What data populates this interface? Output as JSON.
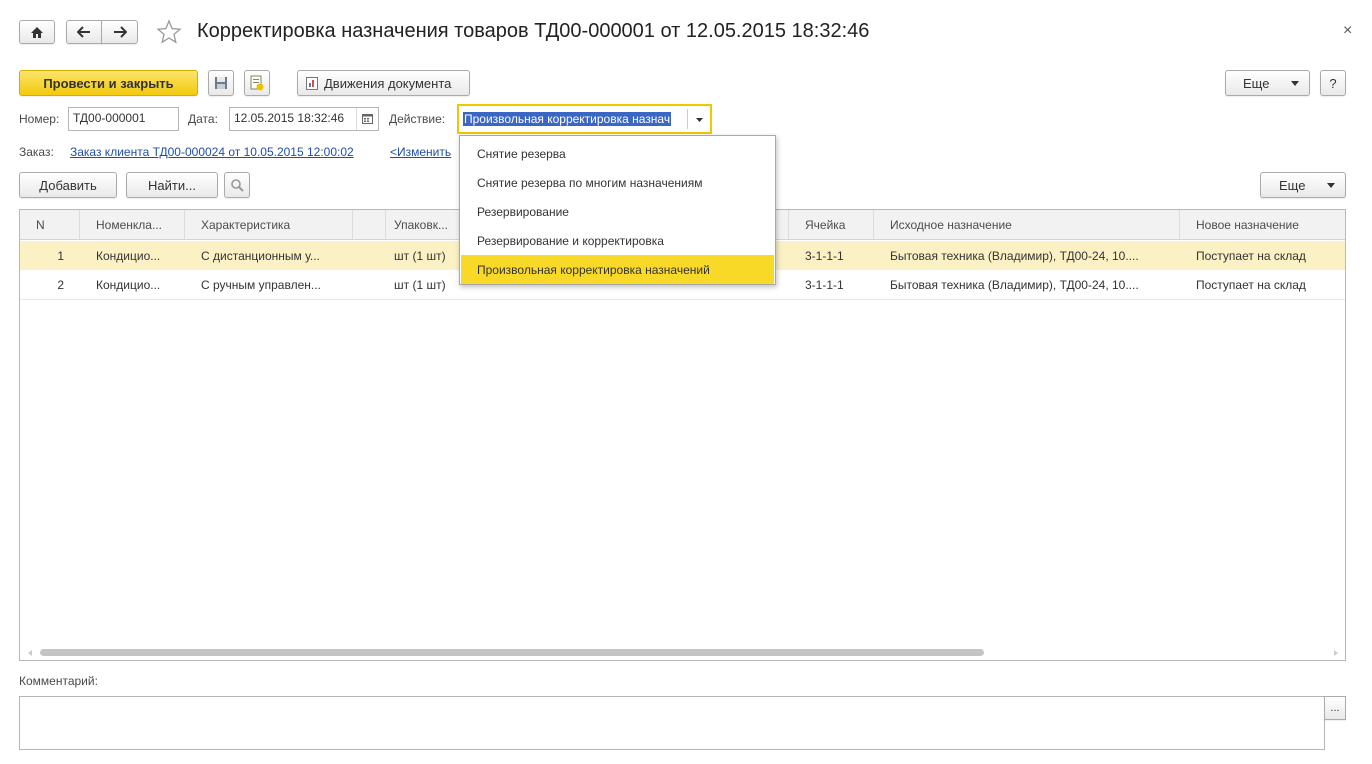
{
  "window": {
    "title": "Корректировка назначения товаров ТД00-000001 от 12.05.2015 18:32:46",
    "close_label": "×"
  },
  "toolbar": {
    "post_close_label": "Провести и закрыть",
    "movements_label": "Движения документа",
    "more_label": "Еще",
    "help_label": "?"
  },
  "form": {
    "number_label": "Номер:",
    "number_value": "ТД00-000001",
    "date_label": "Дата:",
    "date_value": "12.05.2015 18:32:46",
    "action_label": "Действие:",
    "action_value": "Произвольная корректировка назнач",
    "order_label": "Заказ:",
    "order_link": "Заказ клиента ТД00-000024 от 10.05.2015 12:00:02",
    "change_link": "<Изменить"
  },
  "table_toolbar": {
    "add_label": "Добавить",
    "find_label": "Найти...",
    "more_label": "Еще"
  },
  "table": {
    "columns": [
      "N",
      "Номенкла...",
      "Характеристика",
      "",
      "Упаковк...",
      "",
      "Ячейка",
      "Исходное назначение",
      "Новое назначение"
    ],
    "rows": [
      [
        "1",
        "Кондицио...",
        "С дистанционным у...",
        "",
        "шт (1 шт)",
        "",
        "3-1-1-1",
        "Бытовая техника (Владимир), ТД00-24, 10....",
        "Поступает на склад"
      ],
      [
        "2",
        "Кондицио...",
        "С ручным управлен...",
        "",
        "шт (1 шт)",
        "",
        "3-1-1-1",
        "Бытовая техника (Владимир), ТД00-24, 10....",
        "Поступает на склад"
      ]
    ]
  },
  "dropdown": {
    "items": [
      "Снятие резерва",
      "Снятие резерва по многим назначениям",
      "Резервирование",
      "Резервирование и корректировка",
      "Произвольная корректировка назначений"
    ],
    "active_index": 4
  },
  "comment": {
    "label": "Комментарий:",
    "value": "",
    "button_label": "..."
  },
  "colors": {
    "accent": "#f8d928",
    "primary_button": "#f2c90c",
    "selected_row": "#fbf1c5",
    "link": "#1e4fa5",
    "focus_border": "#f0c800"
  },
  "icons": [
    "home-icon",
    "arrow-left-icon",
    "arrow-right-icon",
    "star-icon",
    "save-icon",
    "post-icon",
    "report-icon",
    "calendar-icon",
    "chevron-down-icon",
    "search-clear-icon"
  ]
}
